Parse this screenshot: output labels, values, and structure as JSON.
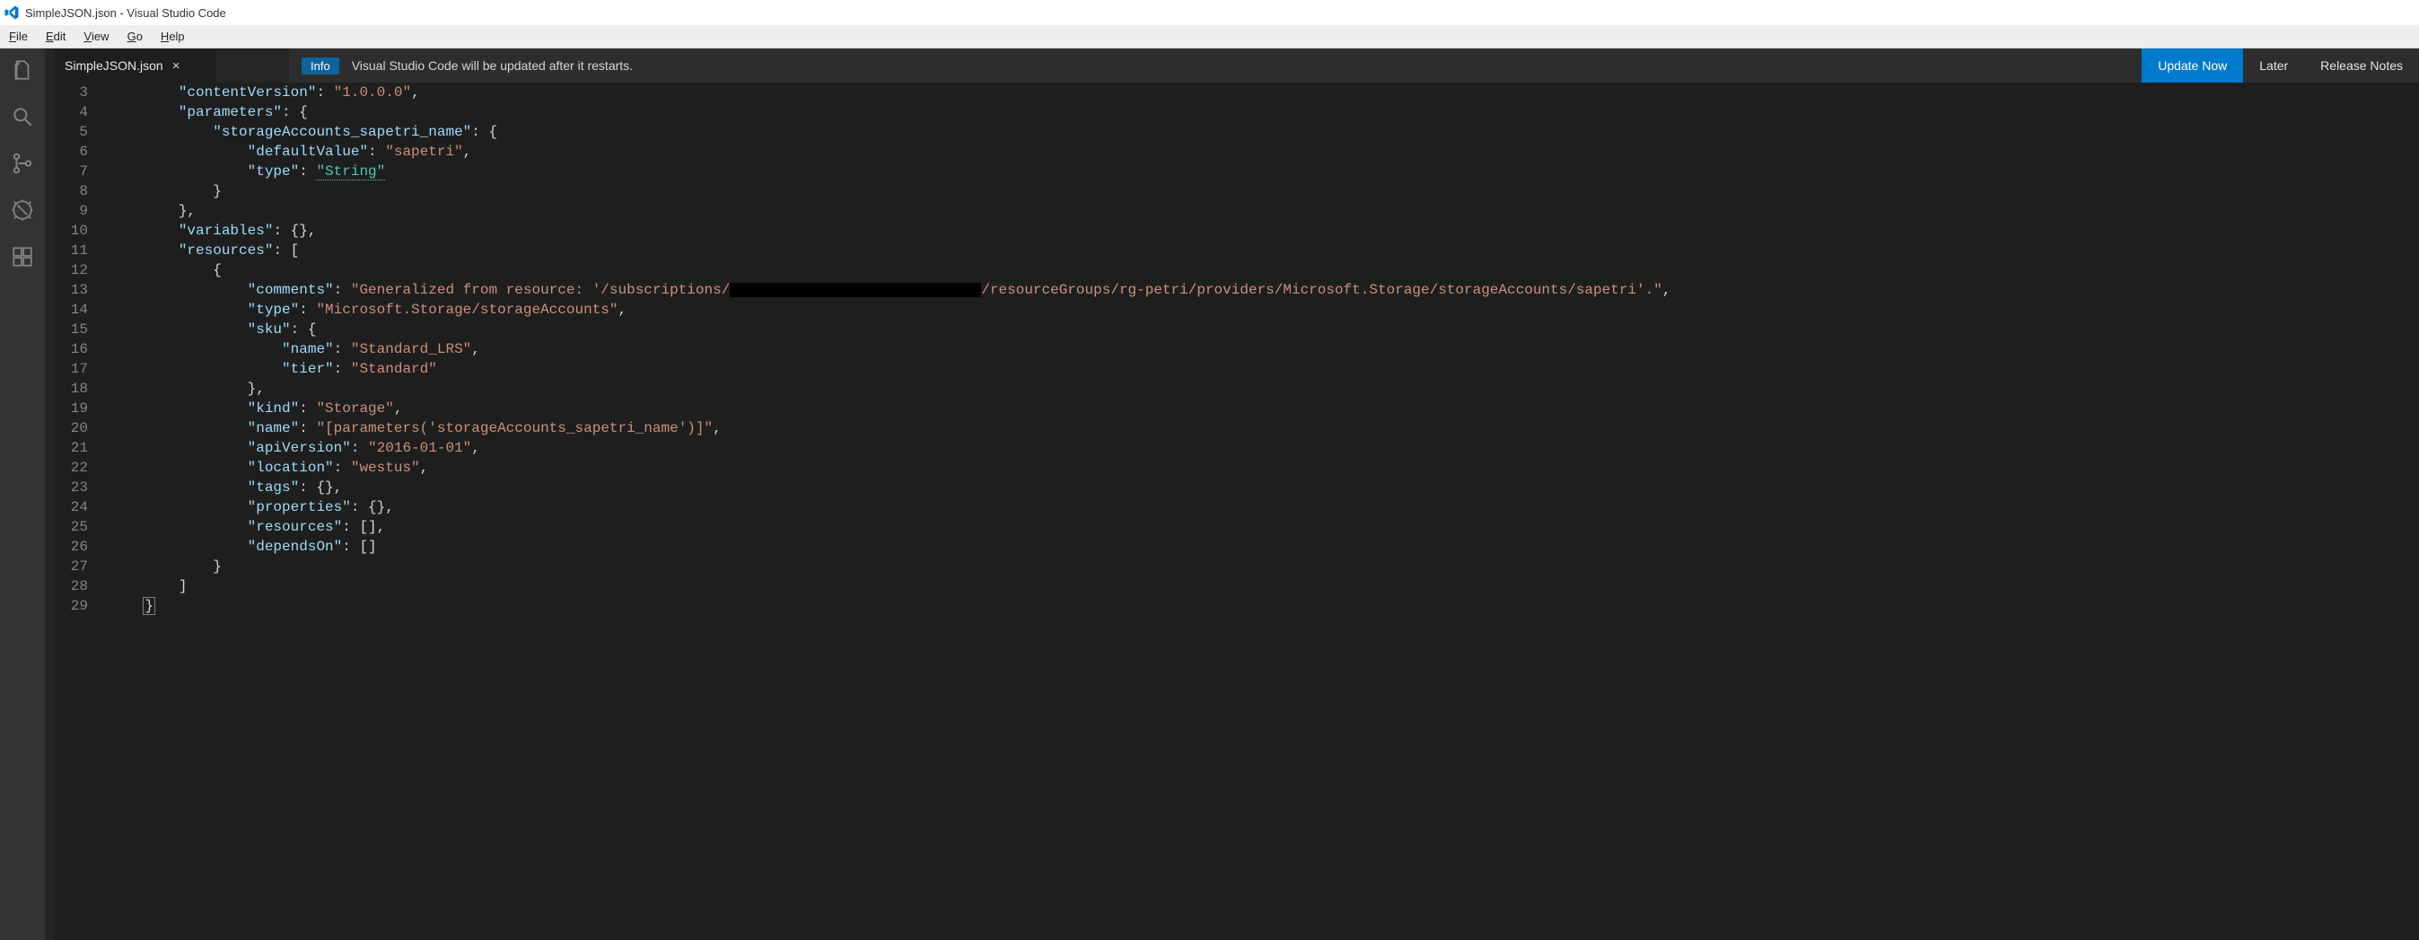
{
  "title_bar": {
    "app_icon": "vscode-logo",
    "title": "SimpleJSON.json - Visual Studio Code"
  },
  "menu": {
    "file": "File",
    "edit": "Edit",
    "view": "View",
    "go": "Go",
    "help": "Help"
  },
  "activity": {
    "explorer": "explorer",
    "search": "search",
    "scm": "source-control",
    "debug": "debug",
    "extensions": "extensions"
  },
  "tabs": {
    "active": {
      "label": "SimpleJSON.json",
      "close": "×"
    }
  },
  "notification": {
    "badge": "Info",
    "message": "Visual Studio Code will be updated after it restarts.",
    "actions": {
      "update": "Update Now",
      "later": "Later",
      "notes": "Release Notes"
    }
  },
  "editor": {
    "first_line_number": 3,
    "last_line_number": 29,
    "lines": {
      "l3": {
        "indent": 8,
        "key": "contentVersion",
        "sep": ": ",
        "val": "\"1.0.0.0\"",
        "tail": ","
      },
      "l4": {
        "indent": 8,
        "key": "parameters",
        "sep": ": ",
        "tail": "{"
      },
      "l5": {
        "indent": 12,
        "key": "storageAccounts_sapetri_name",
        "sep": ": ",
        "tail": "{"
      },
      "l6": {
        "indent": 16,
        "key": "defaultValue",
        "sep": ": ",
        "val": "\"sapetri\"",
        "tail": ","
      },
      "l7": {
        "indent": 16,
        "key": "type",
        "sep": ": ",
        "typeval": "\"String\""
      },
      "l8": {
        "indent": 12,
        "plain": "}"
      },
      "l9": {
        "indent": 8,
        "plain": "},"
      },
      "l10": {
        "indent": 8,
        "key": "variables",
        "sep": ": ",
        "tail": "{},"
      },
      "l11": {
        "indent": 8,
        "key": "resources",
        "sep": ": ",
        "tail": "["
      },
      "l12": {
        "indent": 12,
        "plain": "{"
      },
      "l13": {
        "indent": 16,
        "key": "comments",
        "sep": ": ",
        "strpre": "\"Generalized from resource: '/subscriptions/",
        "redacted": true,
        "strpost": "/resourceGroups/rg-petri/providers/Microsoft.Storage/storageAccounts/sapetri'.\"",
        "tail": ","
      },
      "l14": {
        "indent": 16,
        "key": "type",
        "sep": ": ",
        "val": "\"Microsoft.Storage/storageAccounts\"",
        "tail": ","
      },
      "l15": {
        "indent": 16,
        "key": "sku",
        "sep": ": ",
        "tail": "{"
      },
      "l16": {
        "indent": 20,
        "key": "name",
        "sep": ": ",
        "val": "\"Standard_LRS\"",
        "tail": ","
      },
      "l17": {
        "indent": 20,
        "key": "tier",
        "sep": ": ",
        "val": "\"Standard\""
      },
      "l18": {
        "indent": 16,
        "plain": "},"
      },
      "l19": {
        "indent": 16,
        "key": "kind",
        "sep": ": ",
        "val": "\"Storage\"",
        "tail": ","
      },
      "l20": {
        "indent": 16,
        "key": "name",
        "sep": ": ",
        "val": "\"[parameters('storageAccounts_sapetri_name')]\"",
        "tail": ","
      },
      "l21": {
        "indent": 16,
        "key": "apiVersion",
        "sep": ": ",
        "val": "\"2016-01-01\"",
        "tail": ","
      },
      "l22": {
        "indent": 16,
        "key": "location",
        "sep": ": ",
        "val": "\"westus\"",
        "tail": ","
      },
      "l23": {
        "indent": 16,
        "key": "tags",
        "sep": ": ",
        "tail": "{},"
      },
      "l24": {
        "indent": 16,
        "key": "properties",
        "sep": ": ",
        "tail": "{},"
      },
      "l25": {
        "indent": 16,
        "key": "resources",
        "sep": ": ",
        "tail": "[],"
      },
      "l26": {
        "indent": 16,
        "key": "dependsOn",
        "sep": ": ",
        "tail": "[]"
      },
      "l27": {
        "indent": 12,
        "plain": "}"
      },
      "l28": {
        "indent": 8,
        "plain": "]"
      },
      "l29": {
        "indent": 4,
        "plain_caret": "}"
      }
    }
  }
}
